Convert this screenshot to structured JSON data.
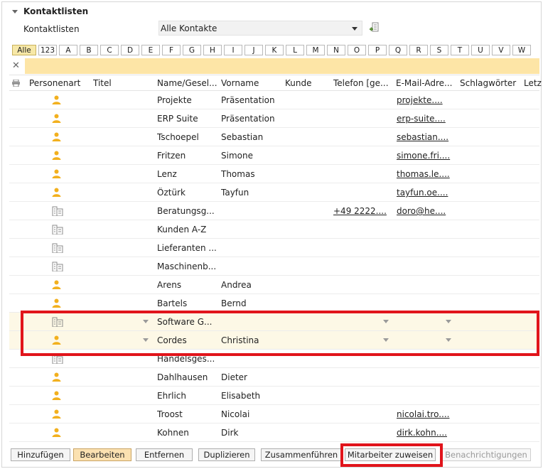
{
  "section": {
    "title": "Kontaktlisten"
  },
  "contactList": {
    "label": "Kontaktlisten",
    "selected": "Alle Kontakte"
  },
  "letters": [
    "Alle",
    "123",
    "A",
    "B",
    "C",
    "D",
    "E",
    "F",
    "G",
    "H",
    "I",
    "J",
    "K",
    "L",
    "M",
    "N",
    "O",
    "P",
    "Q",
    "R",
    "S",
    "T",
    "U",
    "V",
    "W"
  ],
  "columns": {
    "personenart": "Personenart",
    "titel": "Titel",
    "name": "Name/Gesel...",
    "vorname": "Vorname",
    "kunde": "Kunde",
    "telefon": "Telefon [ge...",
    "email": "E-Mail-Adre...",
    "schlagwoerter": "Schlagwörter",
    "letz": "Letz"
  },
  "rows": [
    {
      "type": "person",
      "name": "Projekte",
      "vorname": "Präsentation",
      "telefon": "",
      "email": "projekte...."
    },
    {
      "type": "person",
      "name": "ERP Suite",
      "vorname": "Präsentation",
      "telefon": "",
      "email": "erp-suite...."
    },
    {
      "type": "person",
      "name": "Tschoepel",
      "vorname": "Sebastian",
      "telefon": "",
      "email": "sebastian...."
    },
    {
      "type": "person",
      "name": "Fritzen",
      "vorname": "Simone",
      "telefon": "",
      "email": "simone.fri...."
    },
    {
      "type": "person",
      "name": "Lenz",
      "vorname": "Thomas",
      "telefon": "",
      "email": "thomas.le...."
    },
    {
      "type": "person",
      "name": "Öztürk",
      "vorname": "Tayfun",
      "telefon": "",
      "email": "tayfun.oe...."
    },
    {
      "type": "company",
      "name": "Beratungsg...",
      "vorname": "",
      "telefon": "+49 2222....",
      "email": "doro@he...."
    },
    {
      "type": "company",
      "name": "Kunden A-Z",
      "vorname": "",
      "telefon": "",
      "email": ""
    },
    {
      "type": "company",
      "name": "Lieferanten ...",
      "vorname": "",
      "telefon": "",
      "email": ""
    },
    {
      "type": "company",
      "name": "Maschinenb...",
      "vorname": "",
      "telefon": "",
      "email": ""
    },
    {
      "type": "person",
      "name": "Arens",
      "vorname": "Andrea",
      "telefon": "",
      "email": ""
    },
    {
      "type": "person",
      "name": "Bartels",
      "vorname": "Bernd",
      "telefon": "",
      "email": ""
    },
    {
      "type": "company",
      "name": "Software G...",
      "vorname": "",
      "telefon": "",
      "email": "",
      "selected": true
    },
    {
      "type": "person",
      "name": "Cordes",
      "vorname": "Christina",
      "telefon": "",
      "email": "",
      "selected": true
    },
    {
      "type": "company",
      "name": "Handelsges...",
      "vorname": "",
      "telefon": "",
      "email": ""
    },
    {
      "type": "person",
      "name": "Dahlhausen",
      "vorname": "Dieter",
      "telefon": "",
      "email": ""
    },
    {
      "type": "person",
      "name": "Ehrlich",
      "vorname": "Elisabeth",
      "telefon": "",
      "email": ""
    },
    {
      "type": "person",
      "name": "Troost",
      "vorname": "Nicolai",
      "telefon": "",
      "email": "nicolai.tro...."
    },
    {
      "type": "person",
      "name": "Kohnen",
      "vorname": "Dirk",
      "telefon": "",
      "email": "dirk.kohn...."
    }
  ],
  "buttons": {
    "add": "Hinzufügen",
    "edit": "Bearbeiten",
    "remove": "Entfernen",
    "duplicate": "Duplizieren",
    "merge": "Zusammenführen",
    "assign": "Mitarbeiter zuweisen",
    "notify": "Benachrichtigungen"
  },
  "colors": {
    "accent": "#fde5a6",
    "highlight": "#e1141b",
    "person_icon": "#f2b01e",
    "building_icon": "#8b8b8b"
  }
}
